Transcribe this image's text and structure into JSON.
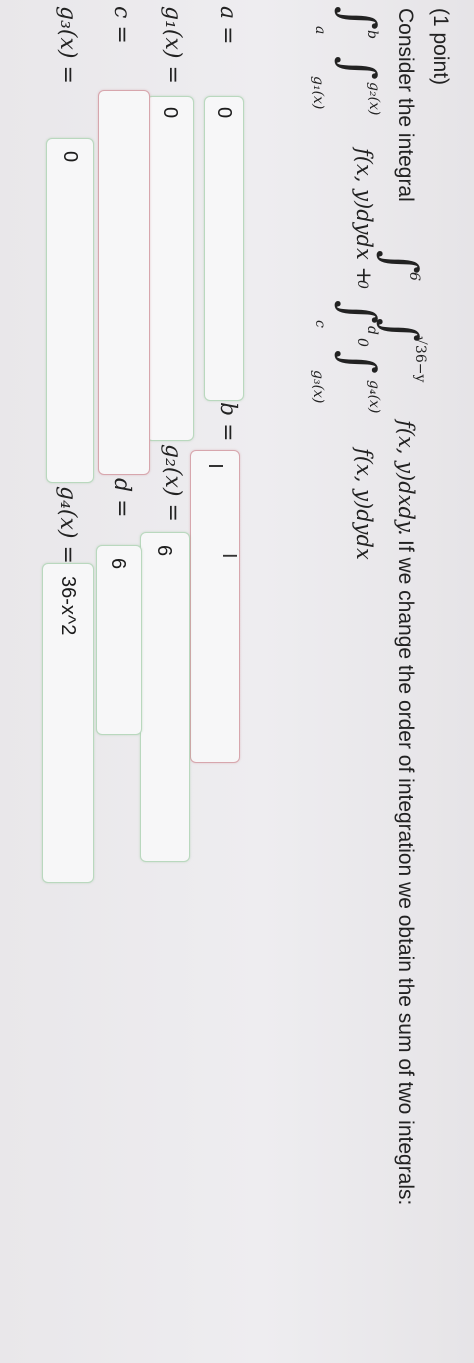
{
  "header": {
    "points": "(1 point)"
  },
  "problem": {
    "intro": "Consider the integral",
    "outer_int_lower": "0",
    "outer_int_upper": "6",
    "inner_int_lower": "0",
    "inner_int_upper": "√36−y",
    "integrand": "f(x, y)dxdy.",
    "sentence": "If we change the order of integration we obtain the sum of two integrals:"
  },
  "sum": {
    "int1_lower": "a",
    "int1_upper": "b",
    "int1_inner_lower": "g₁(x)",
    "int1_inner_upper": "g₂(x)",
    "int1_integrand": "f(x, y)dydx +",
    "int2_lower": "c",
    "int2_upper": "d",
    "int2_inner_lower": "g₃(x)",
    "int2_inner_upper": "g₄(x)",
    "int2_integrand": "f(x, y)dydx"
  },
  "fields": {
    "a_label": "a =",
    "a_value": "0",
    "b_label": "b =",
    "b_value": "",
    "g1_label": "g₁(x) =",
    "g1_value": "0",
    "g2_label": "g₂(x) =",
    "g2_value": "6",
    "c_label": "c =",
    "c_value": "",
    "d_label": "d =",
    "d_value": "6",
    "g3_label": "g₃(x) =",
    "g3_value": "0",
    "g4_label": "g₄(x) =",
    "g4_value": "36-x^2"
  },
  "cursor": {
    "icon": "text-cursor-icon",
    "glyph": "I"
  }
}
